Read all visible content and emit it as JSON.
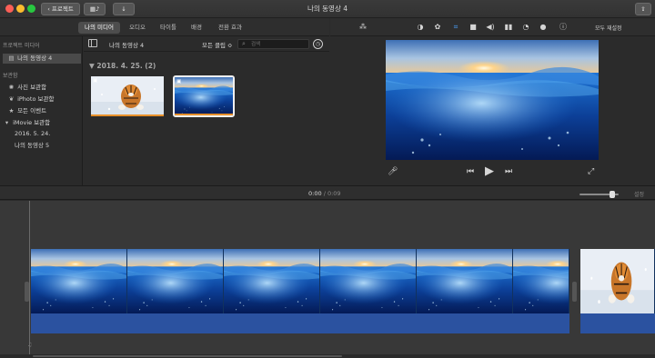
{
  "window": {
    "title": "나의 동영상 4"
  },
  "toolbar": {
    "projects_label": "프로젝트"
  },
  "tabs": [
    {
      "label": "나의 미디어",
      "active": true
    },
    {
      "label": "오디오",
      "active": false
    },
    {
      "label": "타이틀",
      "active": false
    },
    {
      "label": "배경",
      "active": false
    },
    {
      "label": "전환 효과",
      "active": false
    }
  ],
  "viewer_toolbar": {
    "icons": [
      "magic-wand-icon",
      "color-balance-icon",
      "color-correction-icon",
      "crop-icon",
      "stabilization-icon",
      "volume-icon",
      "noise-reduction-icon",
      "speed-icon",
      "clip-filter-icon",
      "info-icon"
    ],
    "reset_all_label": "모두 재설정"
  },
  "sidebar": {
    "sections": [
      {
        "heading": "프로젝트 미디어",
        "items": [
          {
            "label": "나의 동영상 4",
            "icon": "film-icon",
            "selected": true,
            "indent": 1
          }
        ]
      },
      {
        "heading": "보관함",
        "items": [
          {
            "label": "사진 보관함",
            "icon": "photos-icon",
            "selected": false,
            "indent": 1
          },
          {
            "label": "iPhoto 보관함",
            "icon": "iphoto-icon",
            "selected": false,
            "indent": 1
          },
          {
            "label": "모든 이벤트",
            "icon": "star-icon",
            "selected": false,
            "indent": 1
          },
          {
            "label": "iMovie 보관함",
            "icon": "disclosure-triangle-icon",
            "selected": false,
            "indent": 0
          },
          {
            "label": "2016. 5. 24.",
            "icon": "",
            "selected": false,
            "indent": 2
          },
          {
            "label": "나의 동영상 5",
            "icon": "",
            "selected": false,
            "indent": 2
          }
        ]
      }
    ]
  },
  "browser": {
    "title": "나의 동영상 4",
    "filter_label": "모든 클립 ≎",
    "search_placeholder": "검색",
    "date_group": "▼  2018. 4. 25.   (2)",
    "clips": [
      {
        "name": "tiger-photo-clip",
        "selected": false,
        "icon": "camera-icon"
      },
      {
        "name": "ocean-photo-clip",
        "selected": true,
        "icon": "camera-icon"
      }
    ]
  },
  "playback": {
    "current_time": "0:00",
    "separator": "/",
    "duration": "0:09"
  },
  "timeline": {
    "settings_label": "설정",
    "zoom_level": 0.88
  },
  "colors": {
    "accent_orange": "#e8902a",
    "audio_blue": "#2b52a0",
    "selection_gray": "#4a4a4a"
  }
}
